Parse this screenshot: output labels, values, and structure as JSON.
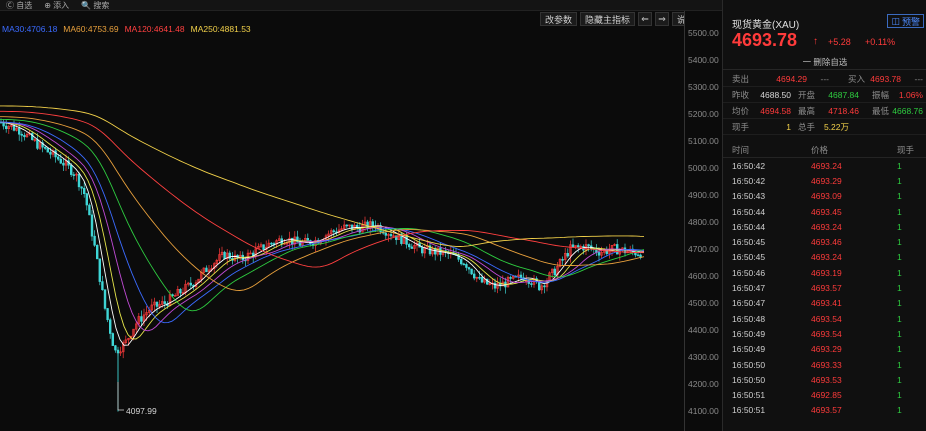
{
  "topbar": {
    "items": [
      "Ⓒ 自选",
      "⊕ 添入",
      "🔍 搜索"
    ]
  },
  "toolbar": {
    "params": "改参数",
    "main_indicator": "隐藏主指标",
    "left": "⇐",
    "right": "⇒",
    "help": "说明"
  },
  "ma_legend": [
    {
      "label": "MA30:4706.18",
      "color": "#3b6bff"
    },
    {
      "label": "MA60:4753.69",
      "color": "#e8a03c"
    },
    {
      "label": "MA120:4641.48",
      "color": "#ff4040"
    },
    {
      "label": "MA250:4881.53",
      "color": "#f2d14a"
    }
  ],
  "yaxis": {
    "ticks": [
      "5500.00",
      "5400.00",
      "5300.00",
      "5200.00",
      "5100.00",
      "5000.00",
      "4900.00",
      "4800.00",
      "4700.00",
      "4600.00",
      "4500.00",
      "4400.00",
      "4300.00",
      "4200.00",
      "4100.00"
    ]
  },
  "chart": {
    "low_label": "4097.99"
  },
  "panel": {
    "title": "现货黄金(XAU)",
    "watch": "预警",
    "price": "4693.78",
    "arrow": "↑",
    "change": "+5.28",
    "pct": "+0.11%",
    "remove": "一 删除自选"
  },
  "quote": {
    "sell_label": "卖出",
    "sell": "4694.29",
    "sell_dash": "---",
    "buy_label": "买入",
    "buy": "4693.78",
    "buy_dash": "---",
    "prev_label": "昨收",
    "prev": "4688.50",
    "open_label": "开盘",
    "open": "4687.84",
    "amp_label": "振幅",
    "amp": "1.06%",
    "avg_label": "均价",
    "avg": "4694.58",
    "high_label": "最高",
    "high": "4718.46",
    "low_label": "最低",
    "low": "4668.76",
    "vol_label": "现手",
    "vol": "1",
    "total_label": "总手",
    "total": "5.22万"
  },
  "ticks_head": {
    "time": "时间",
    "price": "价格",
    "vol": "现手"
  },
  "ticks": [
    {
      "time": "16:50:42",
      "price": "4693.24",
      "vol": "1",
      "vc": "green"
    },
    {
      "time": "16:50:42",
      "price": "4693.29",
      "vol": "1",
      "vc": "red"
    },
    {
      "time": "16:50:43",
      "price": "4693.09",
      "vol": "1",
      "vc": "green"
    },
    {
      "time": "16:50:44",
      "price": "4693.45",
      "vol": "1",
      "vc": "red"
    },
    {
      "time": "16:50:44",
      "price": "4693.24",
      "vol": "1",
      "vc": "green"
    },
    {
      "time": "16:50:45",
      "price": "4693.46",
      "vol": "1",
      "vc": "red"
    },
    {
      "time": "16:50:45",
      "price": "4693.24",
      "vol": "1",
      "vc": "green"
    },
    {
      "time": "16:50:46",
      "price": "4693.19",
      "vol": "1",
      "vc": "green"
    },
    {
      "time": "16:50:47",
      "price": "4693.57",
      "vol": "1",
      "vc": "red"
    },
    {
      "time": "16:50:47",
      "price": "4693.41",
      "vol": "1",
      "vc": "green"
    },
    {
      "time": "16:50:48",
      "price": "4693.54",
      "vol": "1",
      "vc": "red"
    },
    {
      "time": "16:50:49",
      "price": "4693.54",
      "vol": "1",
      "vc": "white"
    },
    {
      "time": "16:50:49",
      "price": "4693.29",
      "vol": "1",
      "vc": "green"
    },
    {
      "time": "16:50:50",
      "price": "4693.33",
      "vol": "1",
      "vc": "red"
    },
    {
      "time": "16:50:50",
      "price": "4693.53",
      "vol": "1",
      "vc": "red"
    },
    {
      "time": "16:50:51",
      "price": "4692.85",
      "vol": "1",
      "vc": "green"
    },
    {
      "time": "16:50:51",
      "price": "4693.57",
      "vol": "1",
      "vc": "red"
    }
  ],
  "colors": {
    "up": "#ff3b3b",
    "down": "#2ecc40",
    "accent": "#4d8bff"
  }
}
